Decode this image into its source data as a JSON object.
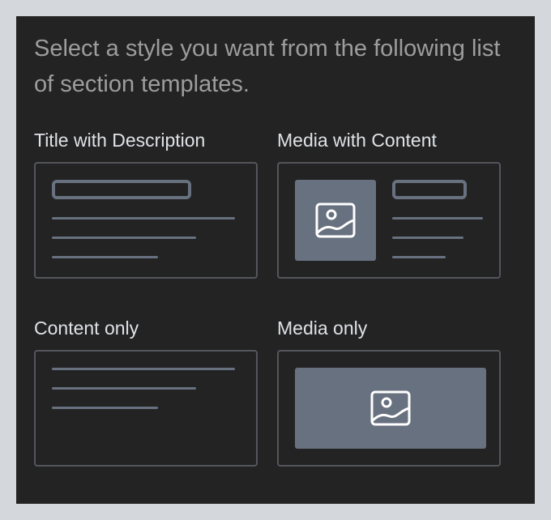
{
  "intro_text": "Select a style you want from the following list of section templates.",
  "templates": [
    {
      "label": "Title with Description",
      "layout": "title-description"
    },
    {
      "label": "Media with Content",
      "layout": "media-content"
    },
    {
      "label": "Content only",
      "layout": "content-only"
    },
    {
      "label": "Media only",
      "layout": "media-only"
    }
  ],
  "colors": {
    "page_background": "#d4d8dd",
    "panel_background": "#232323",
    "intro_text": "#9d9d9d",
    "label_text": "#dfe2e6",
    "card_border": "#53565c",
    "placeholder_fill": "#68717f",
    "icon_stroke": "#ffffff"
  },
  "icons": {
    "media_placeholder": "image-icon"
  }
}
